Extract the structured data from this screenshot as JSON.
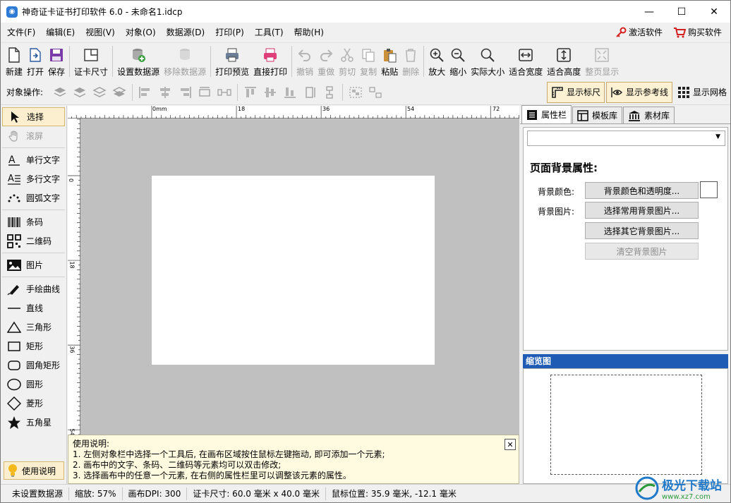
{
  "window": {
    "title": "神奇证卡证书打印软件 6.0 - 未命名1.idcp",
    "controls": {
      "minimize": "—",
      "maximize": "☐",
      "close": "✕"
    }
  },
  "menu": {
    "items": [
      "文件(F)",
      "编辑(E)",
      "视图(V)",
      "对象(O)",
      "数据源(D)",
      "打印(P)",
      "工具(T)",
      "帮助(H)"
    ],
    "activate": "激活软件",
    "buy": "购买软件"
  },
  "toolbar": {
    "new": "新建",
    "open": "打开",
    "save": "保存",
    "card_size": "证卡尺寸",
    "set_datasource": "设置数据源",
    "remove_datasource": "移除数据源",
    "print_preview": "打印预览",
    "direct_print": "直接打印",
    "undo": "撤销",
    "redo": "重做",
    "cut": "剪切",
    "copy": "复制",
    "paste": "粘贴",
    "delete": "删除",
    "zoom_in": "放大",
    "zoom_out": "缩小",
    "actual_size": "实际大小",
    "fit_width": "适合宽度",
    "fit_height": "适合高度",
    "full_page": "整页显示"
  },
  "objbar": {
    "label": "对象操作:",
    "show_ruler": "显示标尺",
    "show_guides": "显示参考线",
    "show_grid": "显示网格"
  },
  "tools": {
    "select": "选择",
    "pan": "滚屏",
    "single_text": "单行文字",
    "multi_text": "多行文字",
    "arc_text": "圆弧文字",
    "barcode": "条码",
    "qrcode": "二维码",
    "image": "图片",
    "freehand": "手绘曲线",
    "line": "直线",
    "triangle": "三角形",
    "rect": "矩形",
    "round_rect": "圆角矩形",
    "circle": "圆形",
    "diamond": "菱形",
    "star": "五角星",
    "help": "使用说明"
  },
  "rulers": {
    "h_labels": [
      "0mm",
      "18",
      "36",
      "54",
      "72"
    ],
    "v_labels": [
      "0",
      "18",
      "36",
      "54"
    ]
  },
  "tips": {
    "title": "使用说明:",
    "line1": "1. 左侧对象栏中选择一个工具后, 在画布区域按住鼠标左键拖动, 即可添加一个元素;",
    "line2": "2. 画布中的文字、条码、二维码等元素均可以双击修改;",
    "line3": "3. 选择画布中的任意一个元素, 在右侧的属性栏里可以调整该元素的属性。",
    "close": "✕"
  },
  "right_panel": {
    "tabs": [
      "属性栏",
      "模板库",
      "素材库"
    ],
    "dropdown_value": "",
    "heading": "页面背景属性:",
    "bg_color_label": "背景颜色:",
    "bg_color_button": "背景颜色和透明度...",
    "bg_image_label": "背景图片:",
    "common_bg_button": "选择常用背景图片...",
    "other_bg_button": "选择其它背景图片...",
    "clear_bg_button": "清空背景图片",
    "preview_title": "缩览图",
    "bg_color": "#ffffff"
  },
  "status": {
    "datasource": "未设置数据源",
    "zoom": "缩放: 57%",
    "dpi": "画布DPI: 300",
    "card_size": "证卡尺寸: 60.0 毫米 x 40.0 毫米",
    "mouse": "鼠标位置: 35.9 毫米, -12.1 毫米"
  },
  "watermark": {
    "brand": "极光下载站",
    "url": "www.xz7.com"
  },
  "colors": {
    "accent": "#1e5bb5",
    "canvas_bg": "#c0c0c0",
    "selected_bg": "#fbefcf",
    "tips_bg": "#fffbe0"
  }
}
